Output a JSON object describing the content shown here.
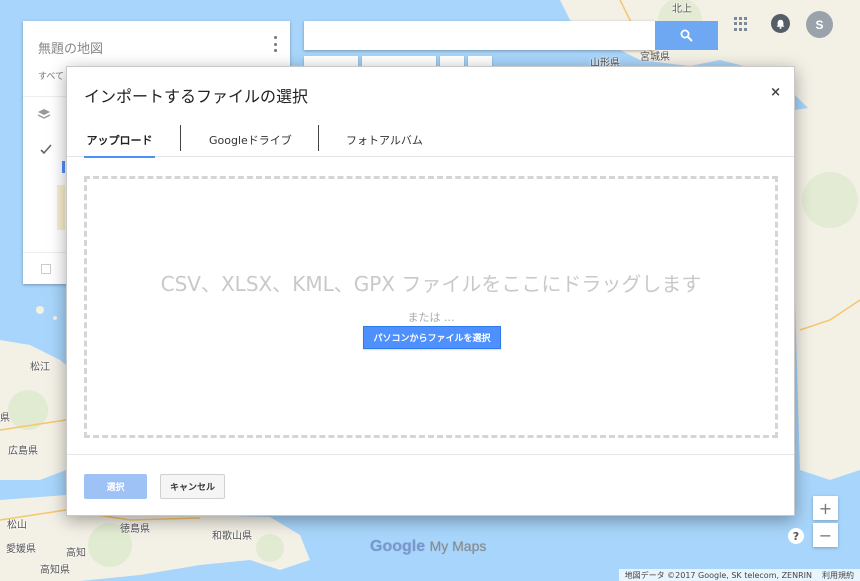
{
  "colors": {
    "accent": "#4d90fe",
    "water": "#a8d5fb",
    "land": "#f4f1e8"
  },
  "left_panel": {
    "title": "無題の地図",
    "subtitle": "すべて"
  },
  "search": {
    "placeholder": "",
    "button_icon": "search-icon"
  },
  "header": {
    "avatar_initial": "S"
  },
  "dialog": {
    "title": "インポートするファイルの選択",
    "close": "×",
    "tabs": [
      {
        "label": "アップロード",
        "active": true
      },
      {
        "label": "Googleドライブ",
        "active": false
      },
      {
        "label": "フォトアルバム",
        "active": false
      }
    ],
    "drop_text": "CSV、XLSX、KML、GPX ファイルをここにドラッグします",
    "or_text": "または ...",
    "select_file_button": "パソコンからファイルを選択",
    "select_button": "選択",
    "cancel_button": "キャンセル"
  },
  "map_labels": [
    "松江",
    "県",
    "広島県",
    "松山",
    "愛媛県",
    "高知",
    "高知県",
    "徳島県",
    "和歌山県",
    "山形県",
    "宮城県",
    "北上"
  ],
  "footer": {
    "logo_google": "Google",
    "logo_mymaps": "My Maps",
    "attribution": "地図データ ©2017 Google, SK telecom, ZENRIN",
    "terms": "利用規約",
    "help": "?",
    "zoom_in": "+",
    "zoom_out": "−"
  }
}
